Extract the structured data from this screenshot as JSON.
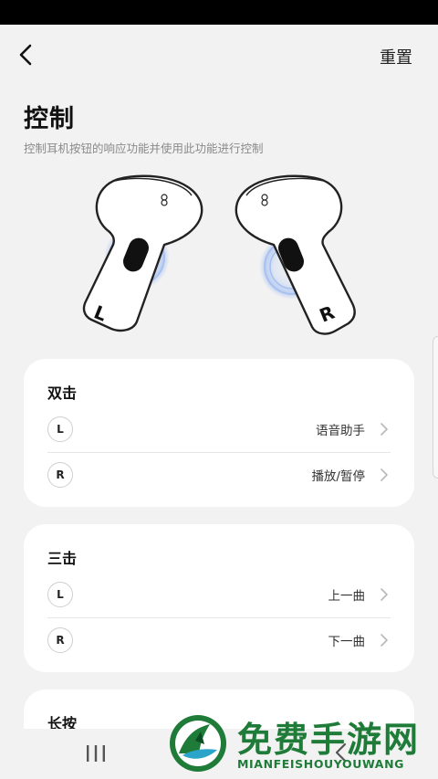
{
  "header": {
    "reset_label": "重置"
  },
  "page": {
    "title": "控制",
    "description": "控制耳机按钮的响应功能并使用此功能进行控制"
  },
  "earbuds": {
    "left_letter": "L",
    "right_letter": "R"
  },
  "sections": [
    {
      "title": "双击",
      "rows": [
        {
          "side": "L",
          "value": "语音助手"
        },
        {
          "side": "R",
          "value": "播放/暂停"
        }
      ]
    },
    {
      "title": "三击",
      "rows": [
        {
          "side": "L",
          "value": "上一曲"
        },
        {
          "side": "R",
          "value": "下一曲"
        }
      ]
    },
    {
      "title": "长按"
    }
  ],
  "watermark": {
    "title": "免费手游网",
    "subtitle": "MIANFEISHOUYOUWANG"
  },
  "colors": {
    "accent_watermark": "#1e7b38",
    "card_bg": "#ffffff",
    "page_bg": "#f2f2f2",
    "ripple": "#3d7cf0"
  }
}
